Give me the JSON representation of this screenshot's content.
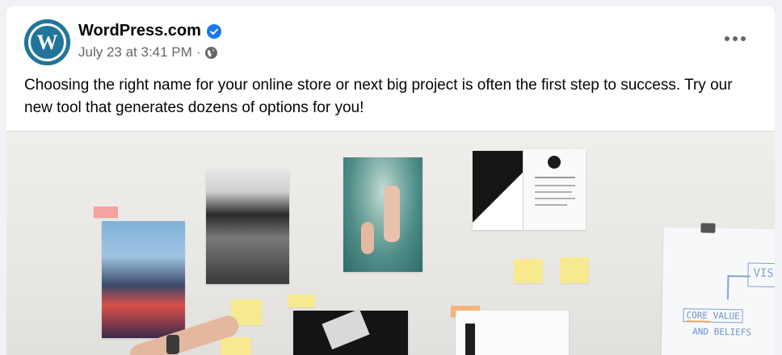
{
  "post": {
    "page_name": "WordPress.com",
    "verified_icon": "verified-check-icon",
    "timestamp": "July 23 at 3:41 PM",
    "separator": "·",
    "audience_icon": "globe-icon",
    "menu_icon": "more-options-icon",
    "text": "Choosing the right name for your online store or next big project is often the first step to success. Try our new tool that generates dozens of options for you!",
    "avatar_logo": "W"
  },
  "colors": {
    "brand": "#21759b",
    "verified": "#1877f2",
    "secondary_text": "#65676b"
  },
  "image": {
    "sketch_text_1": "CORE VALUE",
    "sketch_text_2": "AND BELIEFS",
    "sketch_text_3": "VIS"
  }
}
